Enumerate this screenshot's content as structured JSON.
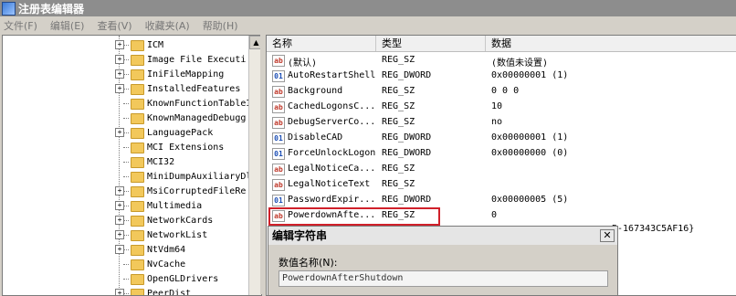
{
  "window": {
    "title": "注册表编辑器"
  },
  "menu": [
    "文件(F)",
    "编辑(E)",
    "查看(V)",
    "收藏夹(A)",
    "帮助(H)"
  ],
  "tree": {
    "items": [
      {
        "label": "ICM",
        "expand": "+"
      },
      {
        "label": "Image File Executi",
        "expand": "+"
      },
      {
        "label": "IniFileMapping",
        "expand": "+"
      },
      {
        "label": "InstalledFeatures",
        "expand": "+"
      },
      {
        "label": "KnownFunctionTableI",
        "expand": ""
      },
      {
        "label": "KnownManagedDebugg",
        "expand": ""
      },
      {
        "label": "LanguagePack",
        "expand": "+"
      },
      {
        "label": "MCI Extensions",
        "expand": ""
      },
      {
        "label": "MCI32",
        "expand": ""
      },
      {
        "label": "MiniDumpAuxiliaryDl",
        "expand": ""
      },
      {
        "label": "MsiCorruptedFileRe",
        "expand": "+"
      },
      {
        "label": "Multimedia",
        "expand": "+"
      },
      {
        "label": "NetworkCards",
        "expand": "+"
      },
      {
        "label": "NetworkList",
        "expand": "+"
      },
      {
        "label": "NtVdm64",
        "expand": "+"
      },
      {
        "label": "NvCache",
        "expand": ""
      },
      {
        "label": "OpenGLDrivers",
        "expand": ""
      },
      {
        "label": "PeerDist",
        "expand": "+"
      }
    ]
  },
  "list": {
    "headers": {
      "name": "名称",
      "type": "类型",
      "data": "数据"
    },
    "rows": [
      {
        "icon": "sz",
        "name": "(默认)",
        "type": "REG_SZ",
        "data": "(数值未设置)"
      },
      {
        "icon": "dw",
        "name": "AutoRestartShell",
        "type": "REG_DWORD",
        "data": "0x00000001 (1)"
      },
      {
        "icon": "sz",
        "name": "Background",
        "type": "REG_SZ",
        "data": "0 0 0"
      },
      {
        "icon": "sz",
        "name": "CachedLogonsC...",
        "type": "REG_SZ",
        "data": "10"
      },
      {
        "icon": "sz",
        "name": "DebugServerCo...",
        "type": "REG_SZ",
        "data": "no"
      },
      {
        "icon": "dw",
        "name": "DisableCAD",
        "type": "REG_DWORD",
        "data": "0x00000001 (1)"
      },
      {
        "icon": "dw",
        "name": "ForceUnlockLogon",
        "type": "REG_DWORD",
        "data": "0x00000000 (0)"
      },
      {
        "icon": "sz",
        "name": "LegalNoticeCa...",
        "type": "REG_SZ",
        "data": ""
      },
      {
        "icon": "sz",
        "name": "LegalNoticeText",
        "type": "REG_SZ",
        "data": ""
      },
      {
        "icon": "dw",
        "name": "PasswordExpir...",
        "type": "REG_DWORD",
        "data": "0x00000005 (5)"
      },
      {
        "icon": "sz",
        "name": "PowerdownAfte...",
        "type": "REG_SZ",
        "data": "0"
      }
    ],
    "partial_data": "B-167343C5AF16}"
  },
  "dialog": {
    "title": "编辑字符串",
    "name_label": "数值名称(N):",
    "name_value": "PowerdownAfterShutdown",
    "close": "✕"
  },
  "colors": {
    "highlight": "#d0202a"
  }
}
